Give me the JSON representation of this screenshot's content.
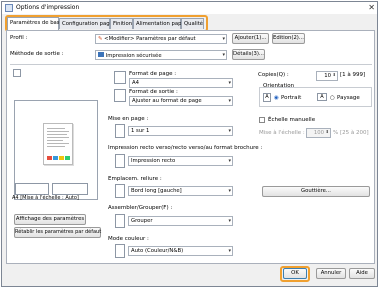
{
  "window": {
    "title": "Options d'impression",
    "close_glyph": "✕"
  },
  "tabs": [
    {
      "label": "Paramètres de base"
    },
    {
      "label": "Configuration page"
    },
    {
      "label": "Finition"
    },
    {
      "label": "Alimentation papier"
    },
    {
      "label": "Qualité"
    }
  ],
  "profile": {
    "label": "Profil :",
    "value": "<Modifier> Paramètres par défaut",
    "add_button": "Ajouter(1)...",
    "edit_button": "Edition(2)..."
  },
  "output_method": {
    "label": "Méthode de sortie :",
    "value": "Impression sécurisée",
    "details_button": "Détails(3)..."
  },
  "preview": {
    "caption": "A4 [Mise à l'échelle : Auto]"
  },
  "left_buttons": {
    "show_settings": "Affichage des paramètres",
    "restore_defaults": "Rétablir les paramètres par défaut"
  },
  "page_format": {
    "label": "Format de page :",
    "value": "A4"
  },
  "output_format": {
    "label": "Format de sortie :",
    "value": "Ajuster au format de page"
  },
  "copies": {
    "label": "Copies(Q) :",
    "value": "10",
    "range": "[1 à 999]"
  },
  "orientation": {
    "label": "Orientation",
    "portrait": "Portrait",
    "landscape": "Paysage"
  },
  "layout": {
    "label": "Mise en page :",
    "value": "1 sur 1"
  },
  "manual_scaling": {
    "label": "Échelle manuelle",
    "field_label": "Mise à l'échelle :",
    "value": "100",
    "range": "% [25 à 200]"
  },
  "duplex": {
    "label": "Impression recto verso/recto verso/au format brochure :",
    "value": "Impression recto"
  },
  "binding": {
    "label": "Emplacem. reliure :",
    "value": "Bord long [gauche]",
    "gutter_button": "Gouttière..."
  },
  "collate": {
    "label": "Assembler/Grouper(F) :",
    "value": "Grouper"
  },
  "color_mode": {
    "label": "Mode couleur :",
    "value": "Auto (Couleur/N&B)"
  },
  "footer": {
    "ok": "OK",
    "cancel": "Annuler",
    "help": "Aide"
  }
}
